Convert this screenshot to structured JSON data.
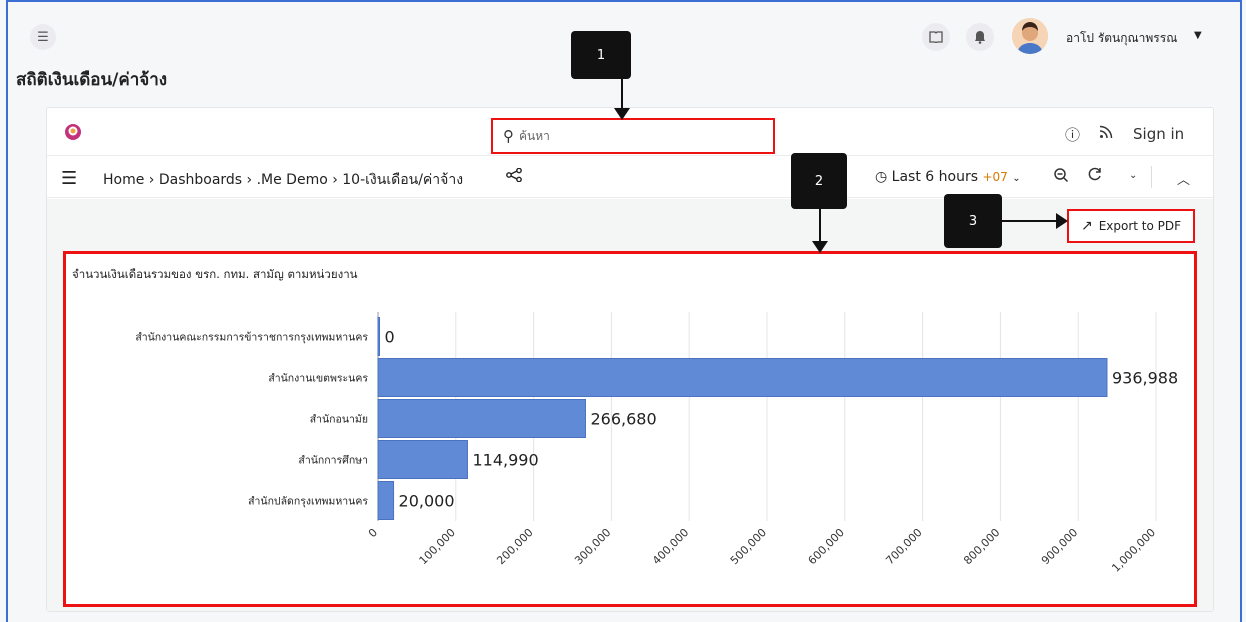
{
  "header": {
    "username": "อาโป รัตนกุณาพรรณ",
    "page_title": "สถิติเงินเดือน/ค่าจ้าง"
  },
  "grafana": {
    "search_placeholder": "ค้นหา",
    "sign_in": "Sign in",
    "breadcrumb": "Home › Dashboards › .Me Demo › 10-เงินเดือน/ค่าจ้าง",
    "time_range": "Last 6 hours",
    "timezone": "+07",
    "export_label": "Export to PDF"
  },
  "callouts": [
    "1",
    "2",
    "3"
  ],
  "icons": {
    "menu": "menu-collapse-icon",
    "book": "book-icon",
    "bell": "bell-icon",
    "search": "search-icon",
    "help": "help-icon",
    "rss": "rss-icon",
    "share": "share-icon",
    "clock": "clock-icon",
    "zoom": "zoom-out-icon",
    "refresh": "refresh-icon",
    "collapse": "chevron-up-icon",
    "export": "external-link-icon"
  },
  "colors": {
    "bar": "#6089d6",
    "highlight": "#e11111",
    "timezone": "#d67b00"
  },
  "chart_data": {
    "type": "bar",
    "orientation": "horizontal",
    "title": "จำนวนเงินเดือนรวมของ ขรก. กทม. สามัญ ตามหน่วยงาน",
    "categories": [
      "สำนักงานคณะกรรมการข้าราชการกรุงเทพมหานคร",
      "สำนักงานเขตพระนคร",
      "สำนักอนามัย",
      "สำนักการศึกษา",
      "สำนักปลัดกรุงเทพมหานคร"
    ],
    "values": [
      0,
      936988,
      266680,
      114990,
      20000
    ],
    "value_labels": [
      "0",
      "936,988",
      "266,680",
      "114,990",
      "20,000"
    ],
    "xlim": [
      0,
      1000000
    ],
    "xticks": [
      "0",
      "100,000",
      "200,000",
      "300,000",
      "400,000",
      "500,000",
      "600,000",
      "700,000",
      "800,000",
      "900,000",
      "1,000,000"
    ],
    "grid": true
  }
}
